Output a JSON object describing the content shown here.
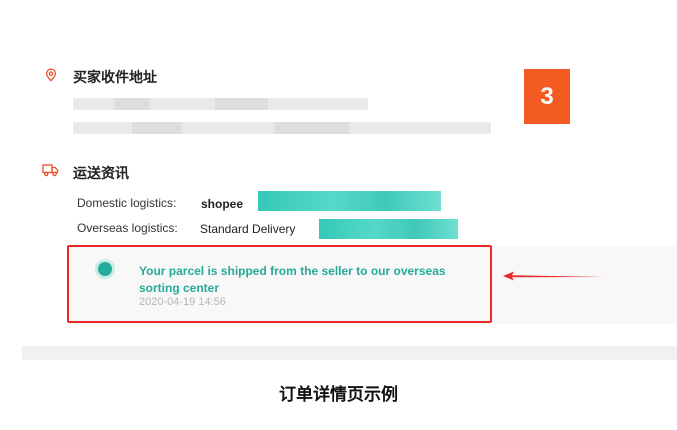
{
  "badge": {
    "number": "3",
    "color": "#f35b22"
  },
  "address": {
    "title": "买家收件地址",
    "icon": "location-pin-icon"
  },
  "shipping": {
    "title": "运送资讯",
    "icon": "truck-icon",
    "domestic": {
      "label": "Domestic logistics:",
      "value": "shopee"
    },
    "overseas": {
      "label": "Overseas logistics:",
      "value": "Standard Delivery"
    }
  },
  "tracking": {
    "event_text": "Your parcel is shipped from the seller to our overseas sorting center",
    "event_time": "2020-04-19 14:56",
    "accent_color": "#26aa99",
    "highlight_color": "#e82a2a"
  },
  "caption": "订单详情页示例"
}
